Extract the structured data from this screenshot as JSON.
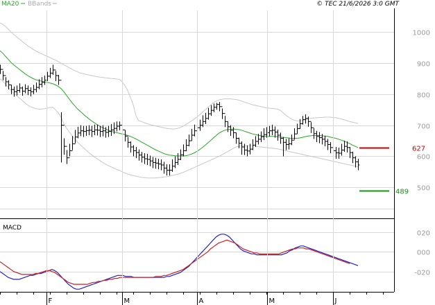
{
  "header": {
    "legend_ma": "MA20",
    "legend_bb": "BBands",
    "copyright": "© TEC 21/6/2026 3:0 GMT"
  },
  "colors": {
    "ma": "#22aa22",
    "bb": "#c8c8c8",
    "price": "#000000",
    "grid": "#d8d8d8",
    "axis": "#000000",
    "resistance": "#cc0000",
    "support": "#119911",
    "macd": "#2222cc",
    "signal": "#cc2222",
    "ma_legend": "#22aa22",
    "bb_legend": "#aaaaaa"
  },
  "chart_data": [
    {
      "type": "ohlc",
      "x_months": [
        "F",
        "M",
        "A",
        "M",
        "J"
      ],
      "y_ticks": [
        500,
        600,
        700,
        800,
        900,
        1000
      ],
      "y_tick_labels": [
        "500",
        "600",
        "700",
        "800",
        "900",
        "1000"
      ],
      "ylim": [
        400,
        1070
      ],
      "price_close": [
        880,
        860,
        840,
        830,
        815,
        808,
        812,
        820,
        810,
        818,
        812,
        808,
        815,
        822,
        832,
        838,
        845,
        858,
        868,
        878,
        860,
        845,
        700,
        632,
        595,
        618,
        640,
        662,
        675,
        682,
        680,
        683,
        684,
        680,
        685,
        684,
        680,
        682,
        677,
        680,
        685,
        690,
        697,
        700,
        685,
        665,
        645,
        630,
        618,
        612,
        604,
        597,
        592,
        590,
        585,
        580,
        578,
        575,
        572,
        562,
        555,
        555,
        568,
        580,
        590,
        605,
        618,
        635,
        650,
        668,
        682,
        692,
        700,
        712,
        722,
        737,
        748,
        758,
        767,
        760,
        738,
        712,
        695,
        684,
        676,
        658,
        642,
        630,
        620,
        617,
        623,
        636,
        648,
        655,
        663,
        670,
        676,
        682,
        684,
        678,
        668,
        658,
        645,
        638,
        640,
        652,
        672,
        689,
        705,
        718,
        722,
        712,
        692,
        673,
        664,
        660,
        655,
        648,
        638,
        628,
        618,
        611,
        610,
        620,
        632,
        628,
        612,
        595,
        582,
        572
      ],
      "price_high": [
        895,
        875,
        855,
        845,
        830,
        825,
        828,
        835,
        825,
        832,
        828,
        822,
        830,
        838,
        848,
        855,
        860,
        872,
        885,
        895,
        875,
        862,
        742,
        658,
        620,
        640,
        665,
        685,
        695,
        700,
        698,
        698,
        700,
        698,
        702,
        702,
        698,
        700,
        694,
        698,
        704,
        709,
        712,
        712,
        700,
        684,
        662,
        648,
        636,
        630,
        622,
        614,
        610,
        608,
        602,
        598,
        595,
        592,
        590,
        582,
        574,
        574,
        590,
        600,
        610,
        622,
        638,
        655,
        670,
        688,
        702,
        712,
        718,
        732,
        740,
        756,
        765,
        770,
        772,
        775,
        754,
        730,
        712,
        700,
        694,
        676,
        660,
        648,
        640,
        635,
        640,
        655,
        665,
        672,
        680,
        690,
        694,
        698,
        702,
        696,
        686,
        676,
        662,
        656,
        658,
        670,
        690,
        705,
        720,
        730,
        735,
        728,
        710,
        690,
        682,
        678,
        672,
        666,
        656,
        646,
        636,
        630,
        628,
        640,
        650,
        648,
        630,
        615,
        600,
        592
      ],
      "price_low": [
        865,
        845,
        825,
        815,
        800,
        792,
        796,
        805,
        795,
        803,
        797,
        793,
        800,
        806,
        816,
        822,
        830,
        842,
        852,
        862,
        842,
        830,
        580,
        605,
        575,
        600,
        620,
        642,
        658,
        665,
        662,
        666,
        668,
        662,
        668,
        667,
        662,
        664,
        660,
        662,
        666,
        672,
        680,
        684,
        668,
        648,
        628,
        612,
        600,
        594,
        586,
        580,
        575,
        572,
        568,
        562,
        560,
        558,
        555,
        544,
        538,
        538,
        550,
        562,
        572,
        588,
        600,
        616,
        632,
        650,
        664,
        674,
        682,
        694,
        704,
        718,
        730,
        742,
        750,
        745,
        720,
        694,
        678,
        666,
        658,
        640,
        626,
        605,
        604,
        600,
        606,
        620,
        630,
        638,
        646,
        652,
        660,
        664,
        668,
        660,
        650,
        640,
        600,
        620,
        622,
        636,
        654,
        672,
        688,
        702,
        705,
        695,
        675,
        656,
        646,
        642,
        638,
        632,
        620,
        610,
        600,
        592,
        592,
        602,
        614,
        612,
        594,
        578,
        564,
        555
      ],
      "ma20": [
        940,
        932,
        922,
        912,
        902,
        894,
        887,
        880,
        873,
        866,
        860,
        855,
        850,
        846,
        844,
        842,
        840,
        838,
        836,
        834,
        830,
        825,
        818,
        808,
        796,
        784,
        772,
        762,
        752,
        744,
        736,
        728,
        721,
        714,
        708,
        702,
        697,
        692,
        688,
        684,
        681,
        678,
        676,
        674,
        672,
        670,
        667,
        664,
        660,
        656,
        651,
        646,
        641,
        636,
        631,
        626,
        621,
        617,
        613,
        609,
        606,
        604,
        603,
        602,
        601,
        601,
        601,
        602,
        604,
        607,
        611,
        616,
        622,
        629,
        636,
        644,
        652,
        660,
        668,
        675,
        680,
        684,
        686,
        687,
        688,
        687,
        686,
        684,
        681,
        678,
        675,
        672,
        670,
        668,
        666,
        665,
        664,
        664,
        664,
        664,
        663,
        662,
        661,
        660,
        659,
        658,
        658,
        658,
        659,
        661,
        663,
        665,
        666,
        667,
        667,
        667,
        666,
        665,
        664,
        662,
        660,
        658,
        655,
        652,
        649,
        645,
        641,
        636,
        632,
        628
      ],
      "bb_upper": [
        1030,
        1025,
        1018,
        1010,
        1000,
        992,
        985,
        978,
        970,
        963,
        956,
        950,
        944,
        939,
        934,
        930,
        926,
        922,
        918,
        914,
        910,
        905,
        900,
        895,
        890,
        885,
        880,
        876,
        872,
        868,
        866,
        864,
        862,
        860,
        858,
        856,
        855,
        854,
        853,
        852,
        851,
        850,
        849,
        848,
        840,
        828,
        812,
        790,
        766,
        730,
        715,
        712,
        708,
        705,
        702,
        700,
        698,
        696,
        694,
        692,
        690,
        689,
        688,
        688,
        690,
        693,
        697,
        702,
        708,
        714,
        720,
        727,
        734,
        742,
        750,
        758,
        766,
        773,
        778,
        782,
        784,
        785,
        785,
        785,
        784,
        783,
        781,
        778,
        775,
        772,
        769,
        766,
        764,
        762,
        760,
        758,
        756,
        755,
        754,
        753,
        752,
        748,
        740,
        732,
        726,
        720,
        716,
        714,
        714,
        716,
        718,
        720,
        722,
        723,
        724,
        725,
        725,
        726,
        726,
        726,
        725,
        724,
        722,
        720,
        718,
        715,
        712,
        710,
        708,
        706
      ],
      "bb_lower": [
        850,
        842,
        832,
        822,
        812,
        802,
        795,
        788,
        780,
        772,
        765,
        760,
        756,
        753,
        752,
        752,
        753,
        755,
        757,
        758,
        750,
        740,
        726,
        705,
        690,
        678,
        666,
        655,
        645,
        636,
        628,
        620,
        612,
        605,
        598,
        592,
        586,
        580,
        575,
        570,
        566,
        562,
        558,
        555,
        550,
        546,
        543,
        540,
        538,
        536,
        534,
        532,
        531,
        530,
        530,
        530,
        530,
        531,
        532,
        533,
        534,
        536,
        538,
        540,
        542,
        545,
        548,
        552,
        556,
        560,
        564,
        568,
        572,
        576,
        580,
        584,
        588,
        592,
        596,
        600,
        605,
        610,
        615,
        620,
        625,
        630,
        632,
        634,
        634,
        634,
        634,
        633,
        632,
        631,
        630,
        629,
        628,
        627,
        626,
        625,
        624,
        622,
        620,
        618,
        616,
        614,
        612,
        610,
        608,
        606,
        604,
        602,
        600,
        598,
        596,
        594,
        592,
        590,
        588,
        586,
        584,
        582,
        580,
        578,
        576,
        574,
        572,
        570,
        568,
        566
      ],
      "levels": [
        {
          "name": "resistance",
          "value": 627,
          "label": "627"
        },
        {
          "name": "support",
          "value": 489,
          "label": "489"
        }
      ]
    },
    {
      "type": "line",
      "title": "MACD",
      "y_ticks": [
        20,
        0,
        -20
      ],
      "y_tick_labels": [
        "020",
        "000",
        "-020"
      ],
      "ylim": [
        -40,
        32
      ],
      "macd": [
        -20,
        -22,
        -24,
        -26,
        -27,
        -28,
        -28,
        -28,
        -27,
        -26,
        -25,
        -24,
        -24,
        -23,
        -22,
        -22,
        -21,
        -20,
        -19,
        -18,
        -19,
        -21,
        -24,
        -27,
        -30,
        -33,
        -35,
        -37,
        -38,
        -38,
        -37,
        -36,
        -35,
        -34,
        -33,
        -32,
        -31,
        -30,
        -29,
        -28,
        -27,
        -26,
        -25,
        -24,
        -24,
        -24,
        -25,
        -25,
        -25,
        -26,
        -26,
        -26,
        -26,
        -26,
        -26,
        -26,
        -26,
        -26,
        -26,
        -26,
        -26,
        -25,
        -25,
        -24,
        -23,
        -22,
        -21,
        -19,
        -17,
        -15,
        -12,
        -9,
        -6,
        -3,
        0,
        3,
        6,
        9,
        12,
        15,
        17,
        18,
        18,
        17,
        15,
        12,
        9,
        6,
        3,
        1,
        0,
        -1,
        -2,
        -2,
        -3,
        -3,
        -3,
        -3,
        -3,
        -3,
        -3,
        -3,
        -3,
        -3,
        -2,
        -1,
        1,
        2,
        4,
        5,
        6,
        6,
        5,
        4,
        3,
        2,
        1,
        0,
        -1,
        -2,
        -3,
        -4,
        -5,
        -6,
        -7,
        -8,
        -9,
        -10,
        -11,
        -12,
        -13,
        -14
      ],
      "signal": [
        -10,
        -12,
        -14,
        -16,
        -18,
        -20,
        -21,
        -22,
        -23,
        -23,
        -23,
        -23,
        -23,
        -22,
        -22,
        -21,
        -20,
        -19,
        -19,
        -20,
        -21,
        -23,
        -25,
        -27,
        -29,
        -31,
        -32,
        -33,
        -33,
        -33,
        -33,
        -33,
        -33,
        -32,
        -31,
        -31,
        -30,
        -30,
        -29,
        -29,
        -28,
        -28,
        -27,
        -27,
        -26,
        -26,
        -26,
        -26,
        -26,
        -26,
        -26,
        -26,
        -26,
        -26,
        -26,
        -26,
        -26,
        -25,
        -25,
        -25,
        -24,
        -24,
        -23,
        -22,
        -21,
        -20,
        -19,
        -18,
        -16,
        -14,
        -12,
        -10,
        -8,
        -6,
        -4,
        -2,
        0,
        3,
        5,
        7,
        9,
        10,
        11,
        12,
        11,
        10,
        9,
        7,
        5,
        3,
        2,
        1,
        0,
        -1,
        -1,
        -2,
        -2,
        -2,
        -2,
        -2,
        -2,
        -2,
        -2,
        -1,
        0,
        1,
        2,
        3,
        3,
        4,
        4,
        4,
        3,
        3,
        2,
        1,
        0,
        -1,
        -2,
        -3,
        -4,
        -5,
        -6,
        -7,
        -8,
        -9,
        -10,
        -11,
        -12
      ]
    }
  ]
}
